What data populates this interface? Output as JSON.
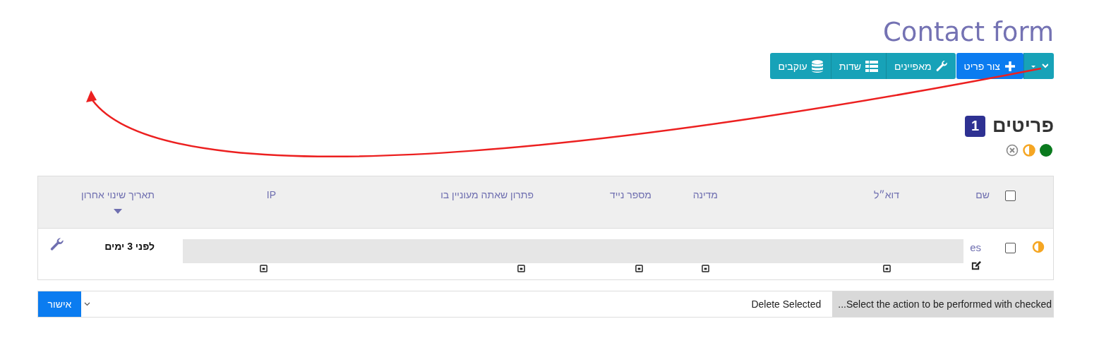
{
  "page": {
    "title": "Contact form"
  },
  "toolbar": [
    {
      "kind": "dropdown"
    },
    {
      "kind": "create",
      "label": "צור פריט"
    },
    {
      "kind": "properties",
      "label": "מאפיינים"
    },
    {
      "kind": "fields",
      "label": "שדות"
    },
    {
      "kind": "followers",
      "label": "עוקבים"
    }
  ],
  "section": {
    "title": "פריטים",
    "count": "1"
  },
  "status_filters": [
    {
      "kind": "done",
      "color": "#0a7a1e"
    },
    {
      "kind": "partial",
      "color": "#f5a623"
    },
    {
      "kind": "cancelled",
      "color": "#888888"
    }
  ],
  "table": {
    "columns": [
      {
        "label": "שם",
        "sorted": false
      },
      {
        "label": "דוא״ל",
        "sorted": false
      },
      {
        "label": "מדינה",
        "sorted": false
      },
      {
        "label": "מספר נייד",
        "sorted": false
      },
      {
        "label": "פתרון שאתה מעוניין בו",
        "sorted": false
      },
      {
        "label": "IP",
        "sorted": false
      },
      {
        "label": "תאריך שינוי אחרון",
        "sorted": true
      }
    ],
    "header_checked": false,
    "rows": [
      {
        "color": "#f5a623",
        "checked": false,
        "name": "es",
        "date": "לפני 3 ימים"
      }
    ]
  },
  "actions_bar": {
    "label": "Select the action to be performed with checked...",
    "value": "Delete Selected",
    "button": "אישור"
  }
}
